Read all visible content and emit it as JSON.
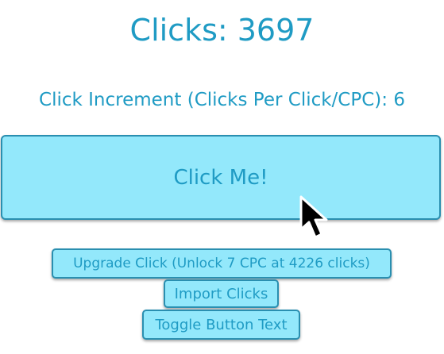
{
  "counter": {
    "clicks_label": "Clicks: 3697"
  },
  "cpc": {
    "text": "Click Increment (Clicks Per Click/CPC): 6"
  },
  "main_button": {
    "label": "Click Me!"
  },
  "buttons": {
    "upgrade_label": "Upgrade Click (Unlock 7 CPC at 4226 clicks)",
    "import_label": "Import Clicks",
    "toggle_label": "Toggle Button Text"
  },
  "colors": {
    "accent_text": "#1f9bc4",
    "button_fill": "#93e8fb",
    "button_border": "#2a8fb0",
    "background": "#ffffff"
  },
  "icons": {
    "cursor": "mouse-pointer-icon"
  }
}
